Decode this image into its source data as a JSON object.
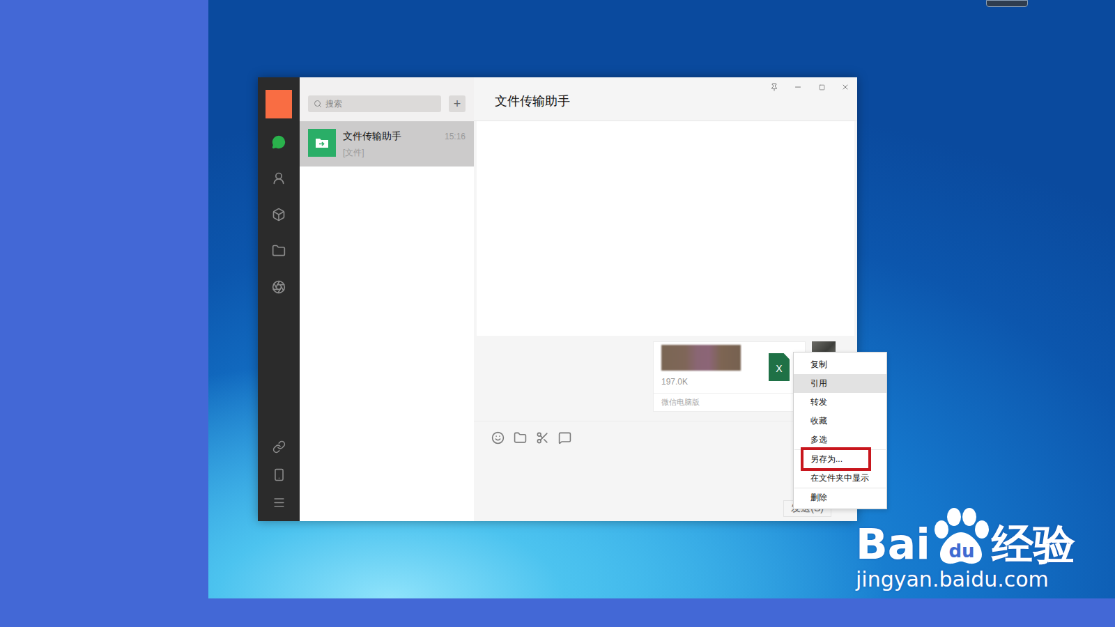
{
  "window": {
    "title": "文件传输助手"
  },
  "search": {
    "placeholder": "搜索",
    "add": "+"
  },
  "chats": [
    {
      "name": "文件传输助手",
      "time": "15:16",
      "preview": "[文件]",
      "selected": true
    }
  ],
  "message": {
    "file_size": "197.0K",
    "file_badge": "X",
    "source": "微信电脑版"
  },
  "input": {
    "send": "发送(S)"
  },
  "context_menu": {
    "items": [
      {
        "label": "复制",
        "hovered": false,
        "highlighted": false,
        "group": 1
      },
      {
        "label": "引用",
        "hovered": true,
        "highlighted": false,
        "group": 1
      },
      {
        "label": "转发",
        "hovered": false,
        "highlighted": false,
        "group": 1
      },
      {
        "label": "收藏",
        "hovered": false,
        "highlighted": false,
        "group": 1
      },
      {
        "label": "多选",
        "hovered": false,
        "highlighted": false,
        "group": 1
      },
      {
        "label": "另存为...",
        "hovered": false,
        "highlighted": true,
        "group": 2
      },
      {
        "label": "在文件夹中显示",
        "hovered": false,
        "highlighted": false,
        "group": 2
      },
      {
        "label": "删除",
        "hovered": false,
        "highlighted": false,
        "group": 3
      }
    ]
  },
  "watermark": {
    "brand_left": "Bai",
    "brand_paw": "du",
    "brand_right": "经验",
    "url": "jingyan.baidu.com"
  }
}
